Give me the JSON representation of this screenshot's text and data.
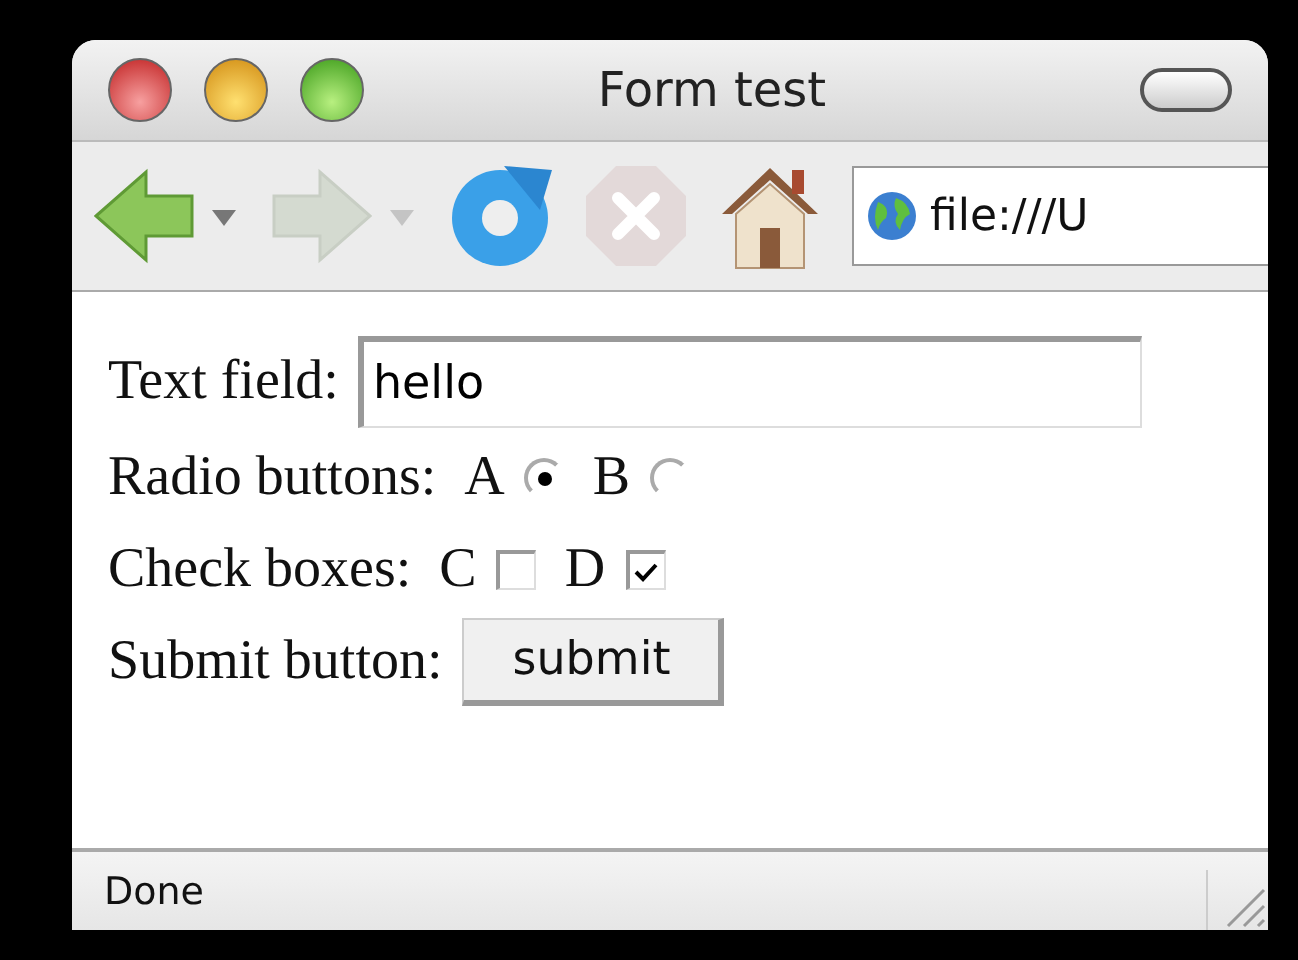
{
  "window": {
    "title": "Form test"
  },
  "toolbar": {
    "buttons": [
      {
        "kind": "back",
        "disabled": false
      },
      {
        "kind": "forward",
        "disabled": true
      },
      {
        "kind": "reload",
        "disabled": false
      },
      {
        "kind": "stop",
        "disabled": true
      },
      {
        "kind": "home",
        "disabled": false
      }
    ],
    "address": "file:///U"
  },
  "form": [
    {
      "kind": "text",
      "label": "Text field:",
      "value": "hello"
    },
    {
      "kind": "radio",
      "label": "Radio buttons:",
      "options": [
        {
          "label": "A",
          "selected": true
        },
        {
          "label": "B",
          "selected": false
        }
      ]
    },
    {
      "kind": "checkbox",
      "label": "Check boxes:",
      "options": [
        {
          "label": "C",
          "checked": false
        },
        {
          "label": "D",
          "checked": true
        }
      ]
    },
    {
      "kind": "submit",
      "label": "Submit button:",
      "value": "submit"
    }
  ],
  "status_bar": {
    "text": "Done"
  }
}
